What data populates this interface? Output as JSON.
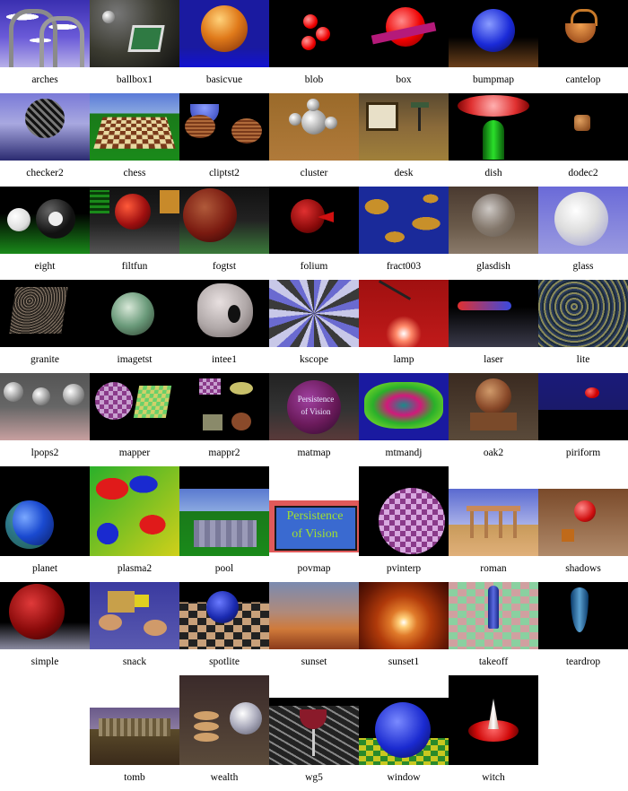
{
  "gallery": {
    "items": [
      {
        "label": "arches"
      },
      {
        "label": "ballbox1"
      },
      {
        "label": "basicvue"
      },
      {
        "label": "blob"
      },
      {
        "label": "box"
      },
      {
        "label": "bumpmap"
      },
      {
        "label": "cantelop"
      },
      {
        "label": "checker2"
      },
      {
        "label": "chess"
      },
      {
        "label": "cliptst2"
      },
      {
        "label": "cluster"
      },
      {
        "label": "desk"
      },
      {
        "label": "dish"
      },
      {
        "label": "dodec2"
      },
      {
        "label": "eight"
      },
      {
        "label": "filtfun"
      },
      {
        "label": "fogtst"
      },
      {
        "label": "folium"
      },
      {
        "label": "fract003"
      },
      {
        "label": "glasdish"
      },
      {
        "label": "glass"
      },
      {
        "label": "granite"
      },
      {
        "label": "imagetst"
      },
      {
        "label": "intee1"
      },
      {
        "label": "kscope"
      },
      {
        "label": "lamp"
      },
      {
        "label": "laser"
      },
      {
        "label": "lite"
      },
      {
        "label": "lpops2"
      },
      {
        "label": "mapper"
      },
      {
        "label": "mappr2"
      },
      {
        "label": "matmap"
      },
      {
        "label": "mtmandj"
      },
      {
        "label": "oak2"
      },
      {
        "label": "piriform"
      },
      {
        "label": "planet"
      },
      {
        "label": "plasma2"
      },
      {
        "label": "pool"
      },
      {
        "label": "povmap"
      },
      {
        "label": "pvinterp"
      },
      {
        "label": "roman"
      },
      {
        "label": "shadows"
      },
      {
        "label": "simple"
      },
      {
        "label": "snack"
      },
      {
        "label": "spotlite"
      },
      {
        "label": "sunset"
      },
      {
        "label": "sunset1"
      },
      {
        "label": "takeoff"
      },
      {
        "label": "teardrop"
      },
      {
        "label": "tomb"
      },
      {
        "label": "wealth"
      },
      {
        "label": "wg5"
      },
      {
        "label": "window"
      },
      {
        "label": "witch"
      }
    ]
  },
  "art": {
    "povmap_text_1": "Persistence",
    "povmap_text_2": "of Vision",
    "matmap_text_1": "Persistence",
    "matmap_text_2": "of Vision"
  }
}
